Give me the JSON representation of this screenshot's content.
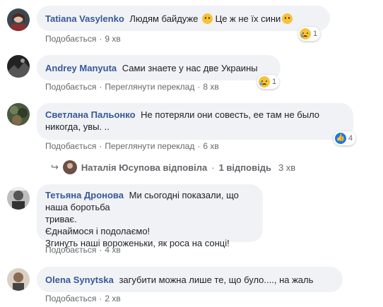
{
  "comments": [
    {
      "author": "Tatiana Vasylenko",
      "text_part1": "Людям байдуже ",
      "text_part2": " Це ж не їх сини",
      "reaction_count": "1",
      "like_label": "Подобається",
      "time": "9 хв"
    },
    {
      "author": "Andrey Manyuta",
      "text": "Сами знаете у нас две Украины",
      "reaction_count": "1",
      "like_label": "Подобається",
      "translate_label": "Переглянути переклад",
      "time": "8 хв"
    },
    {
      "author": "Светлана Пальонко",
      "text_line1": "Не потеряли они совесть, ее там не было",
      "text_line2": "никогда, увы. ..",
      "reaction_count": "4",
      "like_label": "Подобається",
      "translate_label": "Переглянути переклад",
      "time": "6 хв",
      "reply": {
        "name": "Наталія Юсупова відповіла",
        "count": "1 відповідь",
        "time": "3 хв"
      }
    },
    {
      "author": "Тетьяна Дронова",
      "text_line1": "Ми сьогодні показали, що наша боротьба",
      "text_line2": "триває.",
      "text_line3": "Єднаймося і подолаємо!",
      "text_line4": "Згинуть наші вороженьки, як роса на сонці!",
      "like_label": "Подобається",
      "time": "4 хв"
    },
    {
      "author": "Olena Synytska",
      "text": "загубити можна лише те, що було...., на жаль",
      "like_label": "Подобається",
      "time": "2 хв"
    }
  ],
  "colors": {
    "author": "#385898",
    "bubble": "#f0f2f5",
    "meta": "#65676b",
    "like_blue": "#1877f2",
    "emoji_yellow": "#f7c23a"
  }
}
